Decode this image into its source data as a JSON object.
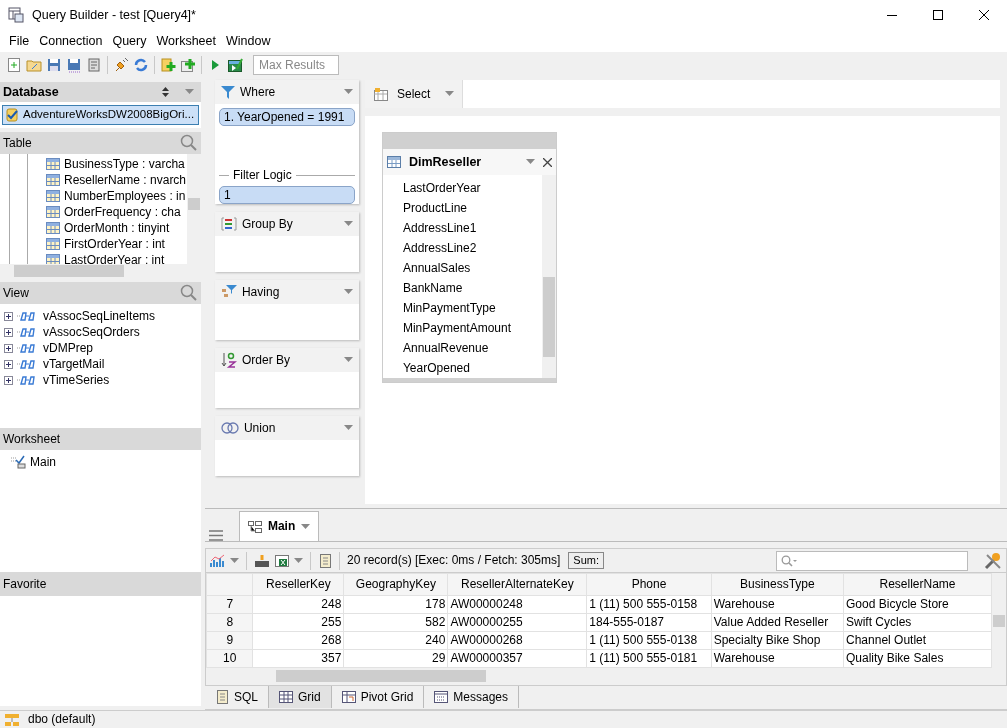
{
  "window": {
    "title": "Query Builder - test [Query4]*"
  },
  "menu": [
    "File",
    "Connection",
    "Query",
    "Worksheet",
    "Window"
  ],
  "toolbar": {
    "max_results": {
      "placeholder": "Max Results"
    }
  },
  "database_panel": {
    "title": "Database",
    "connection": {
      "label": "AdventureWorksDW2008BigOri...",
      "selected": true
    }
  },
  "table_panel": {
    "title": "Table",
    "items": [
      "BusinessType : varcha",
      "ResellerName : nvarch",
      "NumberEmployees : in",
      "OrderFrequency : cha",
      "OrderMonth : tinyint",
      "FirstOrderYear : int",
      "LastOrderYear : int"
    ]
  },
  "view_panel": {
    "title": "View",
    "items": [
      "vAssocSeqLineItems",
      "vAssocSeqOrders",
      "vDMPrep",
      "vTargetMail",
      "vTimeSeries"
    ]
  },
  "worksheet_panel": {
    "title": "Worksheet",
    "items": [
      "Main"
    ]
  },
  "favorite_panel": {
    "title": "Favorite"
  },
  "clauses": [
    {
      "kind": "where",
      "title": "Where",
      "conditions": [
        "1. YearOpened = 1991"
      ],
      "filter_logic": {
        "label": "Filter Logic",
        "value": "1"
      }
    },
    {
      "kind": "group_by",
      "title": "Group By"
    },
    {
      "kind": "having",
      "title": "Having"
    },
    {
      "kind": "order_by",
      "title": "Order By"
    },
    {
      "kind": "union",
      "title": "Union"
    }
  ],
  "select_panel": {
    "title": "Select"
  },
  "table_card": {
    "title": "DimReseller",
    "columns": [
      "LastOrderYear",
      "ProductLine",
      "AddressLine1",
      "AddressLine2",
      "AnnualSales",
      "BankName",
      "MinPaymentType",
      "MinPaymentAmount",
      "AnnualRevenue",
      "YearOpened"
    ]
  },
  "result_tabs": [
    {
      "label": "Main",
      "selected": true
    }
  ],
  "grid_toolbar": {
    "summary": "20 record(s) [Exec: 0ms / Fetch: 305ms]",
    "sum_button": "Sum:"
  },
  "grid": {
    "columns": [
      "ResellerKey",
      "GeographyKey",
      "ResellerAlternateKey",
      "Phone",
      "BusinessType",
      "ResellerName"
    ],
    "rows": [
      {
        "number": "7",
        "cells": [
          "248",
          "178",
          "AW00000248",
          "1 (11) 500 555-0158",
          "Warehouse",
          "Good Bicycle Store"
        ]
      },
      {
        "number": "8",
        "cells": [
          "255",
          "582",
          "AW00000255",
          "184-555-0187",
          "Value Added Reseller",
          "Swift Cycles"
        ]
      },
      {
        "number": "9",
        "cells": [
          "268",
          "240",
          "AW00000268",
          "1 (11) 500 555-0138",
          "Specialty Bike Shop",
          "Channel Outlet"
        ]
      },
      {
        "number": "10",
        "cells": [
          "357",
          "29",
          "AW00000357",
          "1 (11) 500 555-0181",
          "Warehouse",
          "Quality Bike Sales"
        ]
      }
    ]
  },
  "bottom_tabs": [
    {
      "kind": "sql",
      "label": "SQL",
      "selected": false
    },
    {
      "kind": "grid",
      "label": "Grid",
      "selected": true
    },
    {
      "kind": "pivot",
      "label": "Pivot Grid",
      "selected": false
    },
    {
      "kind": "messages",
      "label": "Messages",
      "selected": false
    }
  ],
  "status_bar": {
    "schema": "dbo (default)"
  }
}
